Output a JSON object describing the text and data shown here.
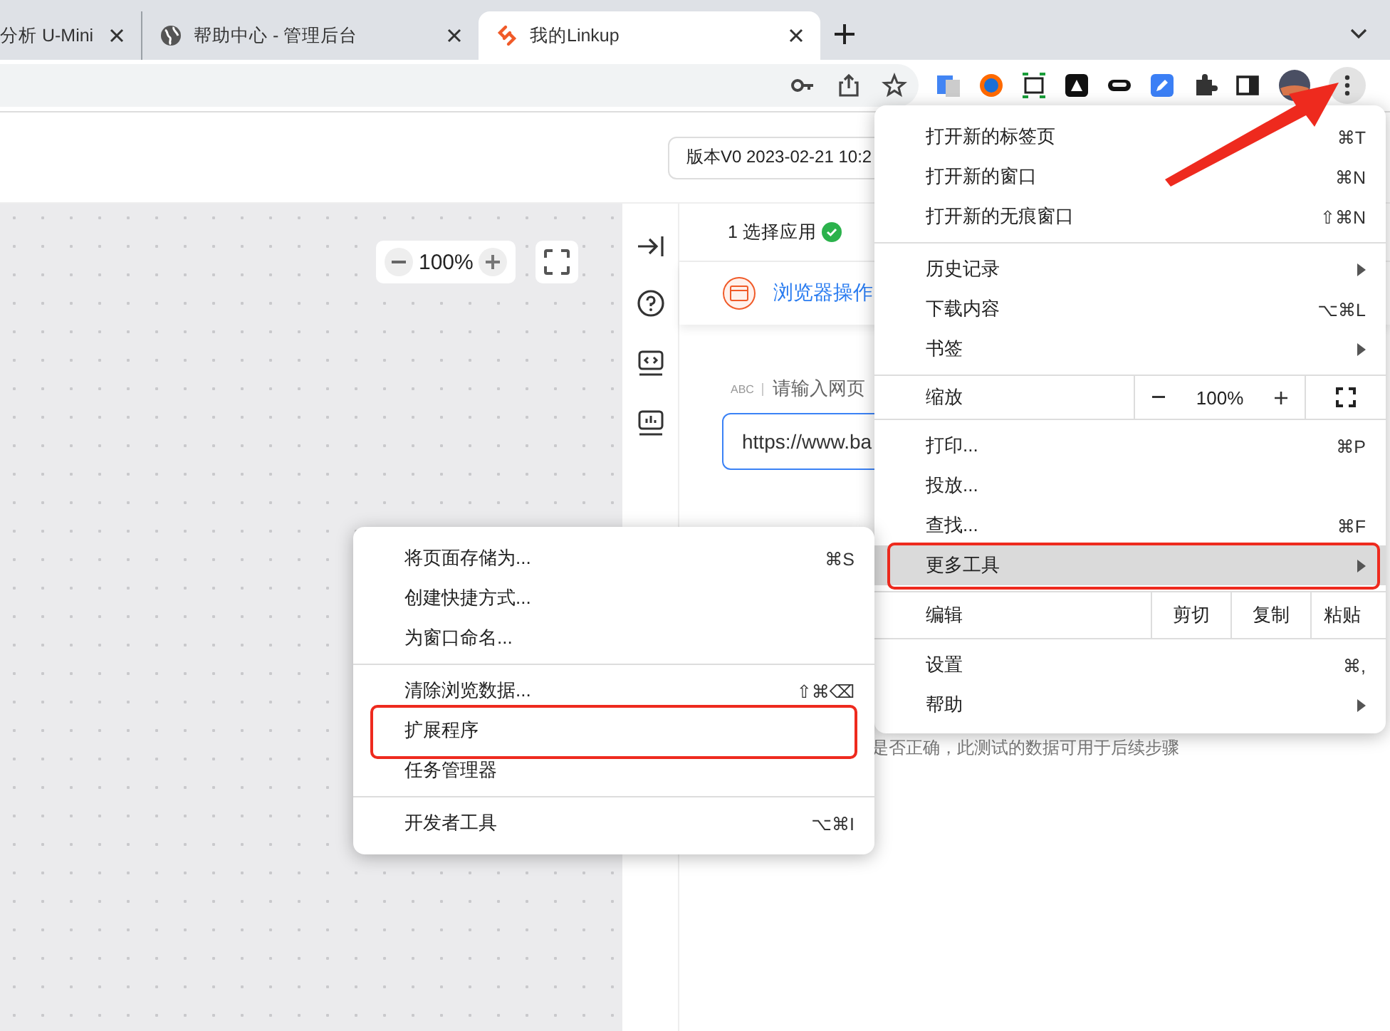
{
  "tabs": [
    {
      "title": "分析 U-Mini",
      "selected": false
    },
    {
      "title": "帮助中心 - 管理后台",
      "selected": false
    },
    {
      "title": "我的Linkup",
      "selected": true
    }
  ],
  "page": {
    "version": "版本V0 2023-02-21 10:2",
    "zoom": "100%",
    "steps": [
      {
        "label": "1 选择应用",
        "done": true
      }
    ],
    "card_title": "浏览器操作",
    "field_tag": "ABC",
    "field_label": "请输入网页",
    "url_value": "https://www.ba",
    "hint": "是否正确，此测试的数据可用于后续步骤"
  },
  "menu": {
    "sections": [
      [
        {
          "kind": "item",
          "label": "打开新的标签页",
          "shortcut": "⌘T",
          "selected": false,
          "annotated": false
        },
        {
          "kind": "item",
          "label": "打开新的窗口",
          "shortcut": "⌘N",
          "selected": false,
          "annotated": false
        },
        {
          "kind": "item",
          "label": "打开新的无痕窗口",
          "shortcut": "⇧⌘N",
          "selected": false,
          "annotated": false
        }
      ],
      [
        {
          "kind": "submenu",
          "label": "历史记录",
          "selected": false,
          "annotated": false
        },
        {
          "kind": "item",
          "label": "下载内容",
          "shortcut": "⌥⌘L",
          "selected": false,
          "annotated": false
        },
        {
          "kind": "submenu",
          "label": "书签",
          "selected": false,
          "annotated": false
        }
      ],
      [
        {
          "kind": "zoom",
          "label": "缩放",
          "value": "100%",
          "selected": false,
          "annotated": false
        }
      ],
      [
        {
          "kind": "item",
          "label": "打印...",
          "shortcut": "⌘P",
          "selected": false,
          "annotated": false
        },
        {
          "kind": "item",
          "label": "投放...",
          "selected": false,
          "annotated": false
        },
        {
          "kind": "item",
          "label": "查找...",
          "shortcut": "⌘F",
          "selected": false,
          "annotated": false
        },
        {
          "kind": "submenu",
          "label": "更多工具",
          "selected": true,
          "annotated": true
        }
      ],
      [
        {
          "kind": "edit",
          "label": "编辑",
          "actions": [
            "剪切",
            "复制",
            "粘贴"
          ],
          "selected": false,
          "annotated": false
        }
      ],
      [
        {
          "kind": "item",
          "label": "设置",
          "shortcut": "⌘,",
          "selected": false,
          "annotated": false
        },
        {
          "kind": "submenu",
          "label": "帮助",
          "selected": false,
          "annotated": false
        }
      ]
    ]
  },
  "submenu": {
    "sections": [
      [
        {
          "kind": "item",
          "label": "将页面存储为...",
          "shortcut": "⌘S",
          "selected": false,
          "annotated": false
        },
        {
          "kind": "item",
          "label": "创建快捷方式...",
          "selected": false,
          "annotated": false
        },
        {
          "kind": "item",
          "label": "为窗口命名...",
          "selected": false,
          "annotated": false
        }
      ],
      [
        {
          "kind": "item",
          "label": "清除浏览数据...",
          "shortcut": "⇧⌘⌫",
          "selected": false,
          "annotated": false
        },
        {
          "kind": "item",
          "label": "扩展程序",
          "selected": false,
          "annotated": true
        },
        {
          "kind": "item",
          "label": "任务管理器",
          "selected": false,
          "annotated": false
        }
      ],
      [
        {
          "kind": "item",
          "label": "开发者工具",
          "shortcut": "⌥⌘I",
          "selected": false,
          "annotated": false
        }
      ]
    ]
  }
}
